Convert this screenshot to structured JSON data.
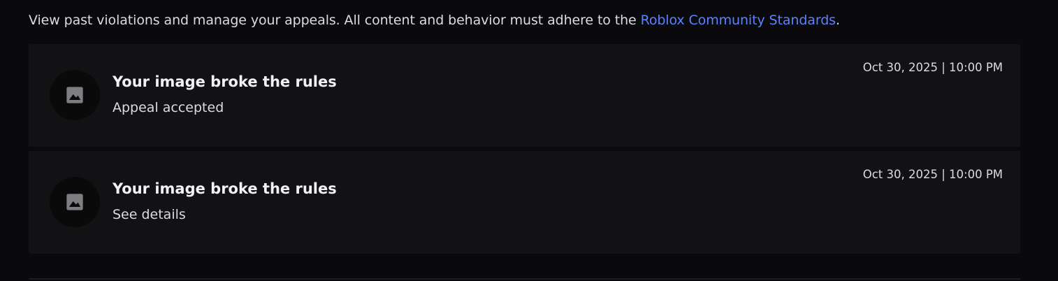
{
  "intro": {
    "text": "View past violations and manage your appeals. All content and behavior must adhere to the ",
    "link_label": "Roblox Community Standards",
    "suffix": "."
  },
  "violations": [
    {
      "icon": "image-icon",
      "title": "Your image broke the rules",
      "status": "Appeal accepted",
      "datetime": "Oct 30, 2025 | 10:00 PM"
    },
    {
      "icon": "image-icon",
      "title": "Your image broke the rules",
      "status": "See details",
      "datetime": "Oct 30, 2025 | 10:00 PM"
    }
  ],
  "colors": {
    "background": "#0a0a0c",
    "card": "#121215",
    "link": "#5b82ff",
    "icon": "#7d7d82"
  }
}
